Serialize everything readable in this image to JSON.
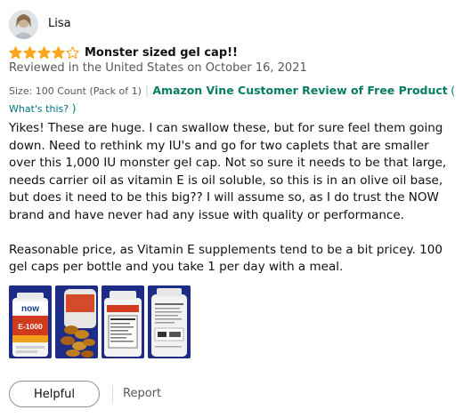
{
  "review": {
    "reviewer_name": "Lisa",
    "rating": 4,
    "rating_max": 5,
    "title": "Monster sized gel cap!!",
    "date_line": "Reviewed in the United States on October 16, 2021",
    "size_line": "Size: 100 Count (Pack of 1)",
    "vine_label": "Amazon Vine Customer Review of Free Product",
    "paren_open": "(",
    "whats_this": "What's this?",
    "paren_close": ")",
    "body": [
      "Yikes! These are huge. I can swallow these, but for sure feel them going down. Need to rethink my IU's and go for two caplets that are smaller over this 1,000 IU monster gel cap. Not so sure it needs to be that large, needs carrier oil as vitamin E is oil soluble, so this is in an olive oil base, but does it need to be this big?? I will assume so, as I do trust the NOW brand and have never had any issue with quality or performance.",
      "Reasonable price, as Vitamin E supplements tend to be a bit pricey. 100 gel caps per bottle and you take 1 per day with a meal."
    ],
    "images": [
      {
        "label": "E-1000",
        "brand": "now"
      },
      {
        "label": "softgels"
      },
      {
        "label": "supplement facts"
      },
      {
        "label": "bottle back"
      }
    ]
  },
  "actions": {
    "helpful_label": "Helpful",
    "report_label": "Report"
  },
  "colors": {
    "star": "#ffa41c",
    "vine_green": "#067d62",
    "link": "#007185",
    "secondary_text": "#565959"
  }
}
